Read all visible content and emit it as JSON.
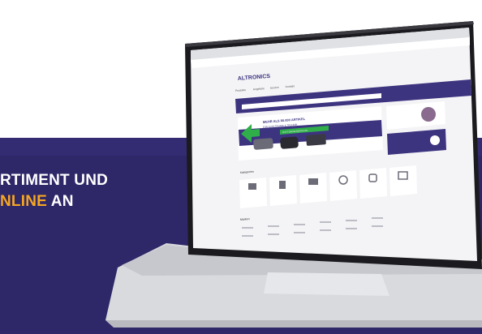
{
  "banner": {
    "line1": "RTIMENT UND",
    "line2_highlight": "NLINE",
    "line2_rest": " AN",
    "bg_color": "#2e2768",
    "highlight_color": "#f5a623"
  },
  "site": {
    "logo": "ALTRONICS",
    "nav": [
      "Produkte",
      "Angebote",
      "Service",
      "Kontakt"
    ],
    "hero_title": "MEHR ALS 80.000 ARTIKEL",
    "hero_subtitle": "FÜR ELEKTRONIK & TECHNIK",
    "hero_cta": "JETZT ONLINE BESTELLEN",
    "section_categories": "Kategorien",
    "section_brands": "Marken"
  },
  "colors": {
    "brand": "#3d3480",
    "accent_green": "#2fae4a",
    "laptop_silver": "#dcdde2"
  }
}
